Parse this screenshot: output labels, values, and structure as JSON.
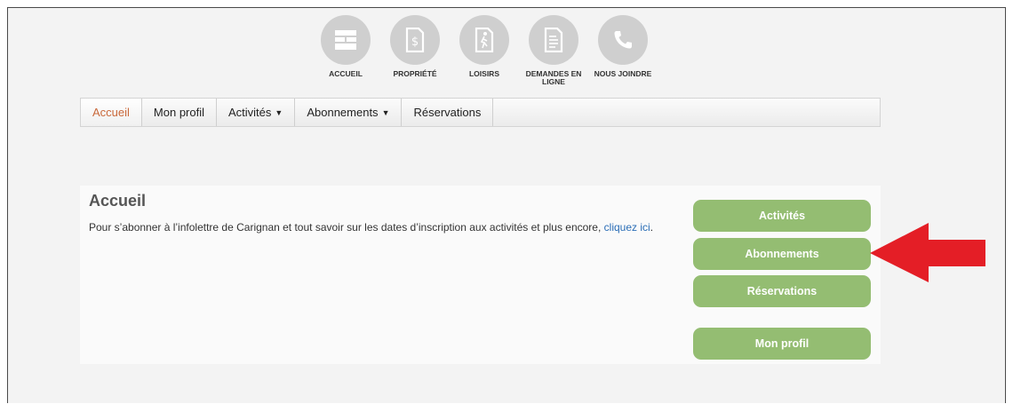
{
  "icon_nav": [
    {
      "label": "ACCUEIL",
      "icon": "building-icon"
    },
    {
      "label": "PROPRIÉTÉ",
      "icon": "tax-bill-icon"
    },
    {
      "label": "LOISIRS",
      "icon": "runner-icon"
    },
    {
      "label": "DEMANDES EN LIGNE",
      "icon": "document-icon"
    },
    {
      "label": "NOUS JOINDRE",
      "icon": "phone-icon"
    }
  ],
  "menu": [
    {
      "label": "Accueil",
      "active": true
    },
    {
      "label": "Mon profil"
    },
    {
      "label": "Activités",
      "caret": "▼"
    },
    {
      "label": "Abonnements",
      "caret": "▼"
    },
    {
      "label": "Réservations"
    }
  ],
  "panel": {
    "title": "Accueil",
    "text_before": "Pour s’abonner à l’infolettre de Carignan et tout savoir sur les dates d’inscription aux activités et plus encore, ",
    "link_text": "cliquez ici",
    "text_after": "."
  },
  "side_buttons": [
    {
      "label": "Activités"
    },
    {
      "label": "Abonnements"
    },
    {
      "label": "Réservations"
    },
    {
      "label": "Mon profil"
    }
  ],
  "colors": {
    "accent_orange": "#c9683a",
    "button_green": "#94bd72",
    "arrow_red": "#e41e26",
    "link_blue": "#2a6db6"
  }
}
